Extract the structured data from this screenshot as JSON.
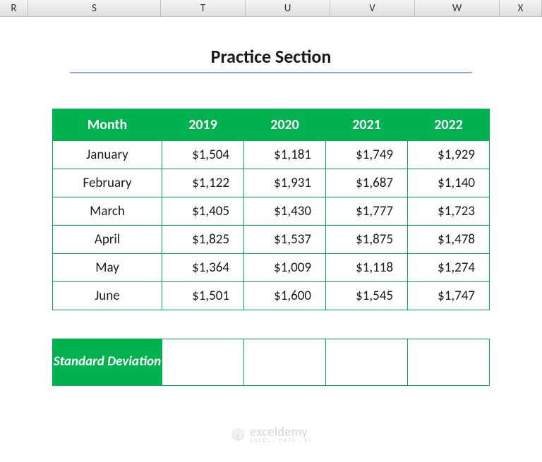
{
  "columns": [
    "R",
    "S",
    "T",
    "U",
    "V",
    "W",
    "X"
  ],
  "title": "Practice Section",
  "table": {
    "headers": [
      "Month",
      "2019",
      "2020",
      "2021",
      "2022"
    ],
    "rows": [
      {
        "month": "January",
        "values": [
          "$1,504",
          "$1,181",
          "$1,749",
          "$1,929"
        ]
      },
      {
        "month": "February",
        "values": [
          "$1,122",
          "$1,931",
          "$1,687",
          "$1,140"
        ]
      },
      {
        "month": "March",
        "values": [
          "$1,405",
          "$1,430",
          "$1,777",
          "$1,723"
        ]
      },
      {
        "month": "April",
        "values": [
          "$1,825",
          "$1,537",
          "$1,875",
          "$1,478"
        ]
      },
      {
        "month": "May",
        "values": [
          "$1,364",
          "$1,009",
          "$1,118",
          "$1,274"
        ]
      },
      {
        "month": "June",
        "values": [
          "$1,501",
          "$1,600",
          "$1,545",
          "$1,747"
        ]
      }
    ]
  },
  "stddev": {
    "label": "Standard Deviation",
    "values": [
      "",
      "",
      "",
      ""
    ]
  },
  "watermark": {
    "brand": "exceldemy",
    "tagline": "EXCEL · DATA · BI"
  }
}
